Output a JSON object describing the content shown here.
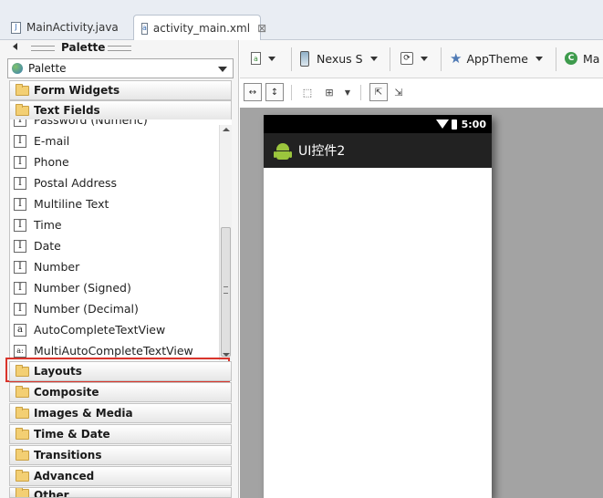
{
  "tabs": [
    {
      "label": "MainActivity.java",
      "icon": "java-file-icon"
    },
    {
      "label": "activity_main.xml",
      "icon": "xml-file-icon"
    }
  ],
  "palette": {
    "title": "Palette",
    "selector_value": "Palette",
    "categories_top": [
      "Form Widgets",
      "Text Fields"
    ],
    "items": [
      {
        "label": "Password (Numeric)",
        "icon": "I"
      },
      {
        "label": "E-mail",
        "icon": "I"
      },
      {
        "label": "Phone",
        "icon": "I"
      },
      {
        "label": "Postal Address",
        "icon": "I"
      },
      {
        "label": "Multiline Text",
        "icon": "I"
      },
      {
        "label": "Time",
        "icon": "I"
      },
      {
        "label": "Date",
        "icon": "I"
      },
      {
        "label": "Number",
        "icon": "I"
      },
      {
        "label": "Number (Signed)",
        "icon": "I"
      },
      {
        "label": "Number (Decimal)",
        "icon": "I"
      },
      {
        "label": "AutoCompleteTextView",
        "icon": "a"
      },
      {
        "label": "MultiAutoCompleteTextView",
        "icon": "a:"
      }
    ],
    "categories_bottom": [
      "Layouts",
      "Composite",
      "Images & Media",
      "Time & Date",
      "Transitions",
      "Advanced",
      "Other"
    ]
  },
  "toolbar": {
    "device": "Nexus S",
    "theme": "AppTheme",
    "activity": "Ma"
  },
  "device_preview": {
    "time": "5:00",
    "app_title": "UI控件2"
  },
  "colors": {
    "highlight_border": "#d9342b",
    "canvas_bg": "#a3a3a3",
    "action_bar": "#222222"
  }
}
